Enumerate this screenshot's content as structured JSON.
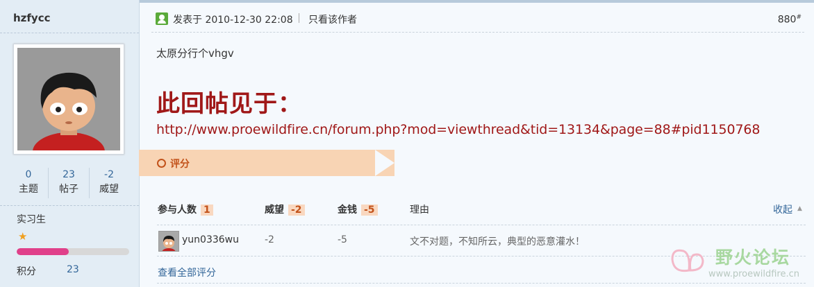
{
  "user": {
    "name": "hzfycc",
    "stats": [
      {
        "value": "0",
        "label": "主题"
      },
      {
        "value": "23",
        "label": "帖子"
      },
      {
        "value": "-2",
        "label": "威望"
      }
    ],
    "rank": "实习生",
    "rank_star_icon": "star-icon",
    "progress": 0.46,
    "credit_label": "积分",
    "credit_value": "23"
  },
  "post": {
    "date_text": "发表于 2010-12-30 22:08",
    "only_author": "只看该作者",
    "floor": "880",
    "floor_suffix": "#",
    "body": "太原分行个vhgv",
    "reply_title": "此回帖见于：",
    "reply_url": "http://www.proewildfire.cn/forum.php?mod=viewthread&tid=13134&page=88#pid1150768"
  },
  "rating": {
    "section_label": "评分",
    "headers": {
      "participants": "参与人数",
      "participants_count": "1",
      "prestige": "威望",
      "prestige_total": "-2",
      "money": "金钱",
      "money_total": "-5",
      "reason": "理由",
      "collapse": "收起"
    },
    "rows": [
      {
        "user": "yun0336wu",
        "prestige": "-2",
        "money": "-5",
        "reason": "文不对题，不知所云，典型的恶意灌水！"
      }
    ],
    "view_all": "查看全部评分"
  },
  "watermark": {
    "text": "野火论坛",
    "url": "www.proewildfire.cn"
  },
  "colors": {
    "accent_red": "#a01818",
    "link_blue": "#336699",
    "ribbon": "#f8d4b4",
    "rating_orange": "#c2521a"
  }
}
